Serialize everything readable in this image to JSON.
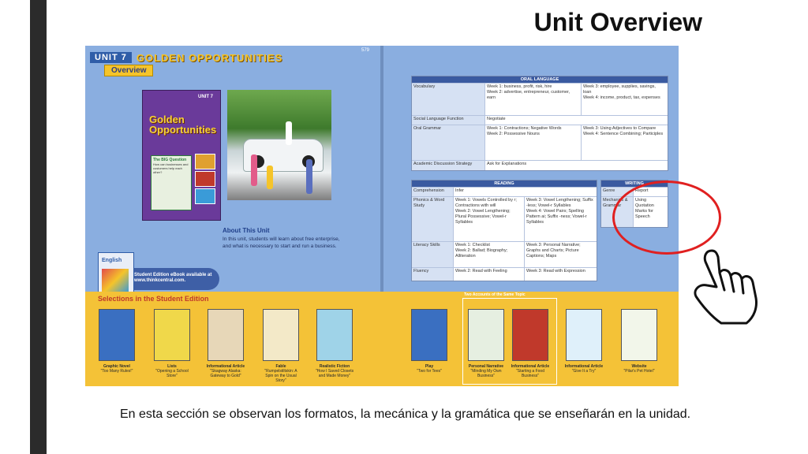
{
  "slide": {
    "title": "Unit Overview",
    "caption": "En esta sección se observan los formatos, la mecánica y la gramática que se enseñarán en la unidad."
  },
  "spread": {
    "unit_label": "UNIT 7",
    "unit_title": "GOLDEN OPPORTUNITIES",
    "overview_tab": "Overview",
    "page_number": "579",
    "cover": {
      "unit": "UNIT 7",
      "title": "Golden Opportunities",
      "big_question": "The BIG Question",
      "question_text": "How can businesses and customers help each other?"
    },
    "about": {
      "heading": "About This Unit",
      "text": "In this unit, students will learn about free enterprise, and what is necessary to start and run a business."
    },
    "side_book_title": "English",
    "ebook": "Student Edition eBook available at www.thinkcentral.com.",
    "selections_heading": "Selections in the Student Edition",
    "two_accounts": "Two Accounts of the Same Topic",
    "selections": [
      {
        "genre": "Graphic Novel",
        "title": "\"Too Many Rules!\"",
        "color": "#3a6fc1"
      },
      {
        "genre": "Lists",
        "title": "\"Opening a School Store\"",
        "color": "#f0d84a"
      },
      {
        "genre": "Informational Article",
        "title": "\"Skagway Alaska: Gateway to Gold\"",
        "color": "#e7d7b8"
      },
      {
        "genre": "Fable",
        "title": "\"Rumpelstiltskin: A Spin on the Usual Story\"",
        "color": "#f3e9c8"
      },
      {
        "genre": "Realistic Fiction",
        "title": "\"How I Saved Closets and Made Money\"",
        "color": "#9fd3e8"
      },
      {
        "genre": "Play",
        "title": "\"Two for Tees\"",
        "color": "#3a6fc1"
      },
      {
        "genre": "Personal Narrative",
        "title": "\"Minding My Own Business\"",
        "color": "#e6efe1"
      },
      {
        "genre": "Informational Article",
        "title": "\"Starting a Food Business\"",
        "color": "#c0392b"
      },
      {
        "genre": "Informational Article",
        "title": "\"Give It a Try\"",
        "color": "#dff0fa"
      },
      {
        "genre": "Website",
        "title": "\"Pilar's Pet Hotel\"",
        "color": "#f2f6ea"
      }
    ],
    "oral_language": {
      "heading": "ORAL LANGUAGE",
      "rows": [
        {
          "label": "Vocabulary",
          "a": "Week 1: business, profit, risk, hire\nWeek 2: advertise, entrepreneur, customer, earn",
          "b": "Week 3: employee, supplies, savings, loan\nWeek 4: income, product, tax, expenses"
        },
        {
          "label": "Social Language Function",
          "a": "Negotiate",
          "b": ""
        },
        {
          "label": "Oral Grammar",
          "a": "Week 1: Contractions; Negative Words\nWeek 2: Possessive Nouns",
          "b": "Week 3: Using Adjectives to Compare\nWeek 4: Sentence Combining; Participles"
        },
        {
          "label": "Academic Discussion Strategy",
          "a": "Ask for Explanations",
          "b": ""
        }
      ]
    },
    "reading": {
      "heading": "READING",
      "rows": [
        {
          "label": "Comprehension",
          "a": "Infer",
          "b": ""
        },
        {
          "label": "Phonics & Word Study",
          "a": "Week 1: Vowels Controlled by r; Contractions with will\nWeek 2: Vowel Lengthening; Plural Possessive; Vowel-r Syllables",
          "b": "Week 3: Vowel Lengthening; Suffix -less; Vowel-r Syllables\nWeek 4: Vowel Pairs; Spelling Pattern ai; Suffix -ness; Vowel-r Syllables"
        },
        {
          "label": "Literacy Skills",
          "a": "Week 1: Checklist\nWeek 2: Ballad; Biography; Alliteration",
          "b": "Week 3: Personal Narrative; Graphs and Charts; Picture Captions; Maps"
        },
        {
          "label": "Fluency",
          "a": "Week 2: Read with Feeling",
          "b": "Week 3: Read with Expression"
        }
      ]
    },
    "writing": {
      "heading": "WRITING",
      "rows": [
        {
          "label": "Genre",
          "a": "Report"
        },
        {
          "label": "Mechanics & Grammar",
          "a": "Using Quotation Marks for Speech"
        }
      ]
    }
  },
  "colors": {
    "spread_bg": "#8aaee0",
    "strip": "#f4c237",
    "highlight_circle": "#e02020"
  },
  "icons": {
    "pointer": "pointing-hand-icon"
  }
}
